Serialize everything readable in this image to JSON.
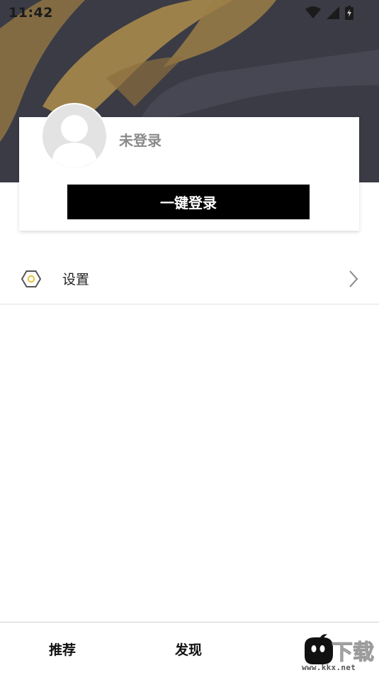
{
  "status_bar": {
    "time": "11:42"
  },
  "profile": {
    "login_status": "未登录",
    "login_button_label": "一键登录"
  },
  "menu": {
    "settings_label": "设置"
  },
  "bottom_nav": {
    "items": [
      {
        "label": "推荐"
      },
      {
        "label": "发现"
      }
    ]
  },
  "watermark": {
    "site": "www.kkx.net",
    "logo_text": "下载"
  },
  "colors": {
    "header_bg": "#3a3b45",
    "accent_gold": "#a8894a",
    "settings_icon_inner": "#e8c43a"
  },
  "icons": {
    "status": [
      "wifi-icon",
      "signal-icon",
      "battery-icon"
    ],
    "settings": "hexagon-settings-icon",
    "chevron": "chevron-right-icon",
    "avatar": "default-avatar-icon"
  }
}
